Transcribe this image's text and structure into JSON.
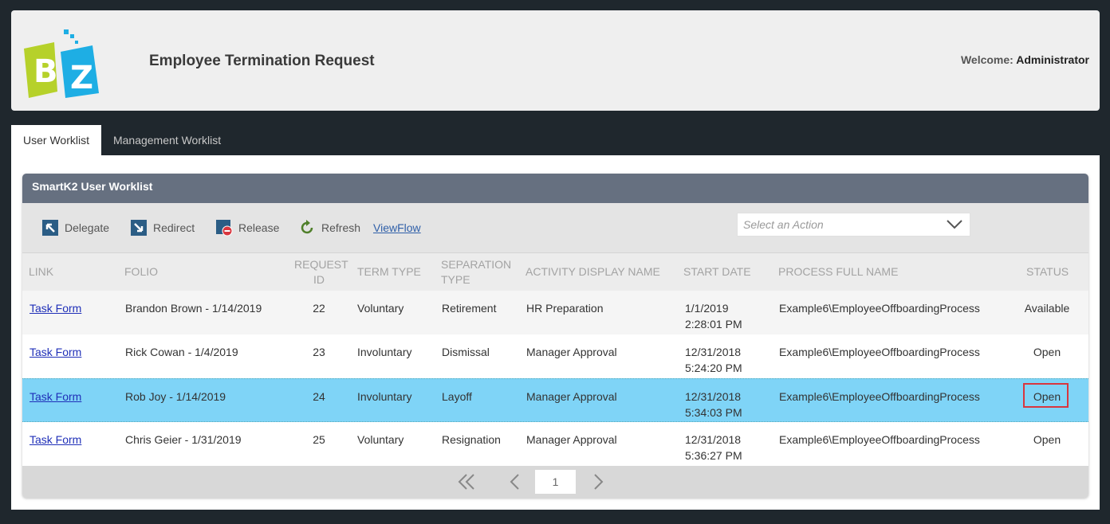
{
  "header": {
    "title": "Employee Termination Request",
    "welcome_label": "Welcome:",
    "user": "Administrator"
  },
  "tabs": [
    {
      "label": "User Worklist",
      "active": true
    },
    {
      "label": "Management Worklist",
      "active": false
    }
  ],
  "panel": {
    "title": "SmartK2 User Worklist"
  },
  "toolbar": {
    "delegate": "Delegate",
    "redirect": "Redirect",
    "release": "Release",
    "refresh": "Refresh",
    "viewflow": "ViewFlow",
    "action_placeholder": "Select an Action"
  },
  "columns": {
    "link": "LINK",
    "folio": "FOLIO",
    "request_id_1": "REQUEST",
    "request_id_2": "ID",
    "term_type": "TERM TYPE",
    "separation_1": "SEPARATION",
    "separation_2": "TYPE",
    "activity": "ACTIVITY DISPLAY NAME",
    "start_date": "START DATE",
    "process": "PROCESS FULL NAME",
    "status": "STATUS"
  },
  "rows": [
    {
      "link": "Task Form",
      "folio": "Brandon Brown - 1/14/2019",
      "id": "22",
      "term": "Voluntary",
      "separation": "Retirement",
      "activity": "HR Preparation",
      "date": "1/1/2019",
      "time": "2:28:01 PM",
      "process": "Example6\\EmployeeOffboardingProcess",
      "status": "Available"
    },
    {
      "link": "Task Form",
      "folio": "Rick Cowan - 1/4/2019",
      "id": "23",
      "term": "Involuntary",
      "separation": "Dismissal",
      "activity": "Manager Approval",
      "date": "12/31/2018",
      "time": "5:24:20 PM",
      "process": "Example6\\EmployeeOffboardingProcess",
      "status": "Open"
    },
    {
      "link": "Task Form",
      "folio": "Rob Joy - 1/14/2019",
      "id": "24",
      "term": "Involuntary",
      "separation": "Layoff",
      "activity": "Manager Approval",
      "date": "12/31/2018",
      "time": "5:34:03 PM",
      "process": "Example6\\EmployeeOffboardingProcess",
      "status": "Open"
    },
    {
      "link": "Task Form",
      "folio": "Chris Geier - 1/31/2019",
      "id": "25",
      "term": "Voluntary",
      "separation": "Resignation",
      "activity": "Manager Approval",
      "date": "12/31/2018",
      "time": "5:36:27 PM",
      "process": "Example6\\EmployeeOffboardingProcess",
      "status": "Open"
    }
  ],
  "pager": {
    "page": "1"
  },
  "icons": {
    "logo": "bz-logo-icon",
    "delegate": "delegate-icon",
    "redirect": "redirect-icon",
    "release": "release-icon",
    "refresh": "refresh-icon",
    "dropdown": "chevron-down-icon",
    "first": "double-chevron-left-icon",
    "prev": "chevron-left-icon",
    "next": "chevron-right-icon"
  },
  "colors": {
    "accent": "#667080",
    "selected_row": "#7fd4f7",
    "highlight_box": "#d9363e"
  }
}
